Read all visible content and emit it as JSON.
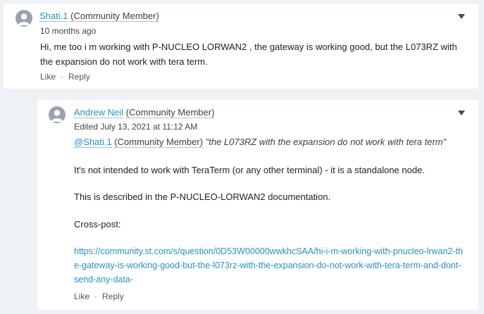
{
  "comments": [
    {
      "author": "Shati.1",
      "role": "(Community Member)",
      "meta": "10 months ago",
      "body": "Hi, me too i m working with P-NUCLEO LORWAN2 , the gateway is working good, but the L073RZ with the expansion do not work with tera term.",
      "like_label": "Like",
      "separator": "·",
      "reply_label": "Reply"
    },
    {
      "author": "Andrew Neil",
      "role": "(Community Member)",
      "meta": "Edited July 13, 2021 at 11:12 AM",
      "mention": "@Shati.1",
      "mention_role": "(Community Member)",
      "quote": "\"the L073RZ with the expansion do not work with tera term\"",
      "para1": "It's not intended to work with TeraTerm (or any other terminal) - it is a standalone node.",
      "para2": "This is described in the P-NUCLEO-LORWAN2 documentation.",
      "para3": "Cross-post:",
      "link": "https://community.st.com/s/question/0D53W00000wwkhcSAA/hi-i-m-working-with-pnucleo-lrwan2-the-gateway-is-working-good-but-the-l073rz-with-the-expansion-do-not-work-with-tera-term-and-dont-send-any-data-",
      "like_label": "Like",
      "separator": "·",
      "reply_label": "Reply"
    }
  ],
  "icons": {
    "avatar": "user-avatar-icon",
    "menu": "chevron-down-icon"
  },
  "colors": {
    "link": "#2a8fc0",
    "background": "#eef1f5",
    "card": "#ffffff"
  }
}
